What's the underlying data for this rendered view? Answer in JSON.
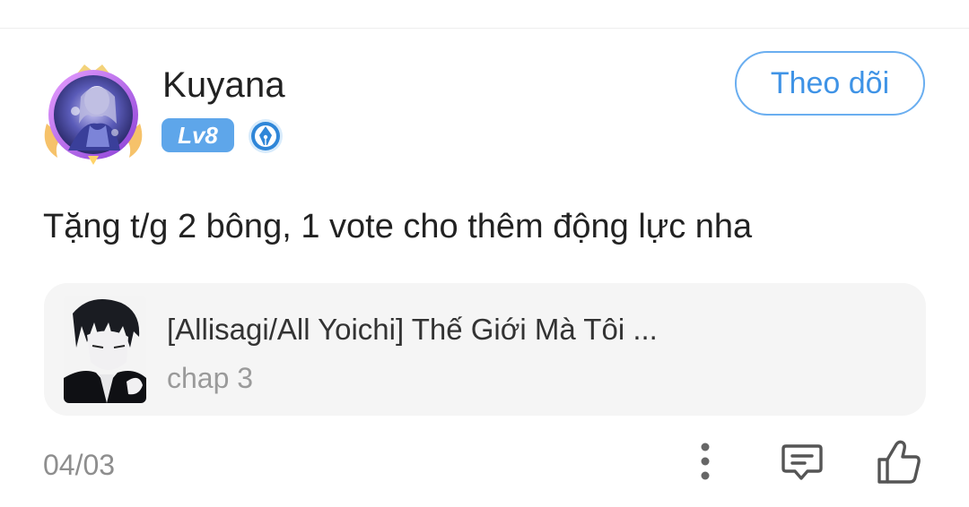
{
  "comment": {
    "user": {
      "name": "Kuyana",
      "level": "Lv8",
      "avatar_icon": "anime-girl-avatar-with-gold-frame",
      "badge_icon": "writer-pen-badge-icon"
    },
    "follow_label": "Theo dõi",
    "text": "Tặng t/g 2 bông, 1 vote cho thêm động lực nha",
    "story": {
      "title": "[Allisagi/All Yoichi] Thế Giới Mà Tôi ...",
      "chapter": "chap 3",
      "cover_icon": "manga-cover-dark-haired-boy"
    },
    "date": "04/03",
    "actions": {
      "more_icon": "more-vertical-icon",
      "reply_icon": "comment-icon",
      "like_icon": "thumbs-up-icon"
    }
  },
  "colors": {
    "accent": "#3f93e6",
    "accent_border": "#6aaef0",
    "level_badge": "#5ea6ea",
    "card_background": "#f5f5f5",
    "muted_text": "#8e8e8e"
  }
}
